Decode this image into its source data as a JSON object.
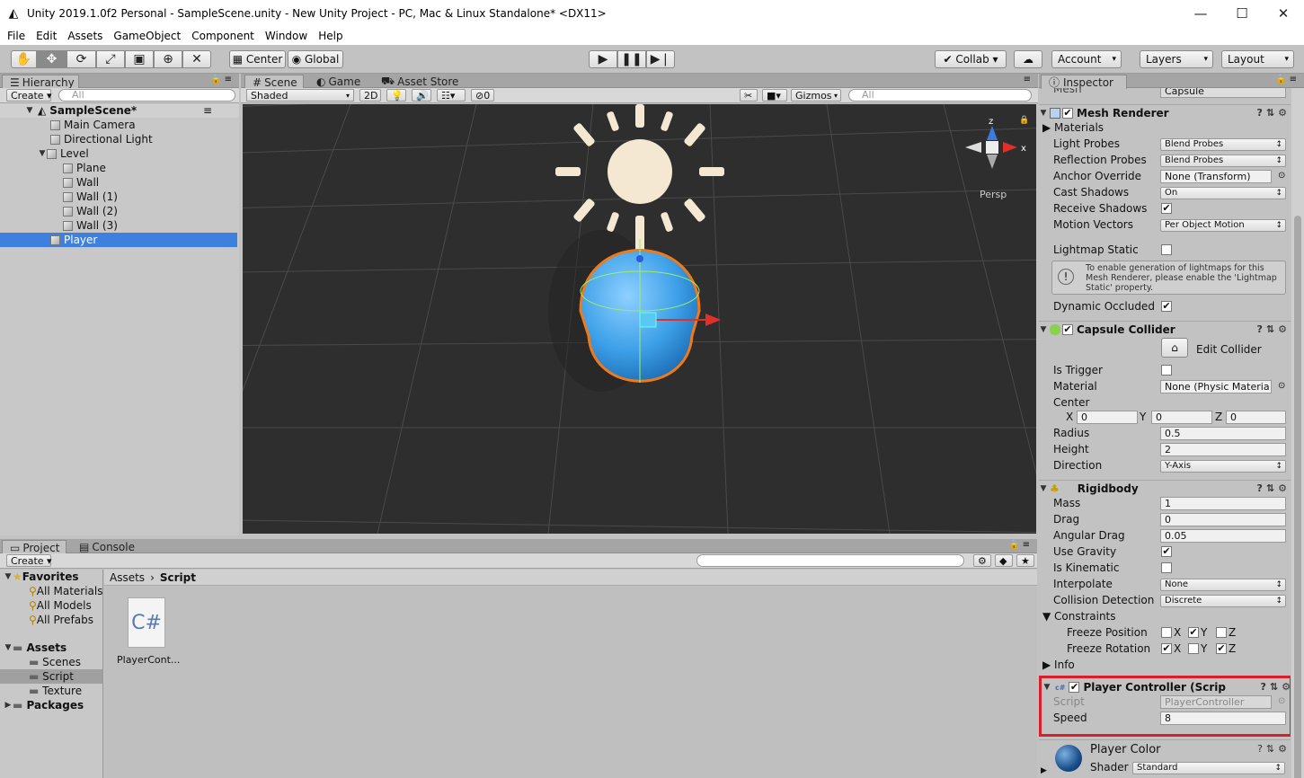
{
  "window": {
    "title": "Unity 2019.1.0f2 Personal - SampleScene.unity - New Unity Project - PC, Mac & Linux Standalone* <DX11>",
    "minimize": "—",
    "maximize": "☐",
    "close": "✕"
  },
  "menu": [
    "File",
    "Edit",
    "Assets",
    "GameObject",
    "Component",
    "Window",
    "Help"
  ],
  "toolbar": {
    "pivot": "Center",
    "space": "Global",
    "collab": "Collab ▾",
    "account": "Account",
    "layers": "Layers",
    "layout": "Layout"
  },
  "hierarchy": {
    "tab": "Hierarchy",
    "create": "Create",
    "search_placeholder": "All",
    "scene": "SampleScene*",
    "items": [
      "Main Camera",
      "Directional Light",
      "Level",
      "Plane",
      "Wall",
      "Wall (1)",
      "Wall (2)",
      "Wall (3)",
      "Player"
    ],
    "selected": "Player"
  },
  "scene": {
    "tabs": [
      "Scene",
      "Game",
      "Asset Store"
    ],
    "shading": "Shaded",
    "mode2d": "2D",
    "fx_count": "0",
    "gizmos": "Gizmos",
    "search_placeholder": "All",
    "persp": "Persp",
    "axis_x": "x",
    "axis_z": "z"
  },
  "project": {
    "tabs": [
      "Project",
      "Console"
    ],
    "create": "Create",
    "favorites": "Favorites",
    "favorite_items": [
      "All Materials",
      "All Models",
      "All Prefabs"
    ],
    "assets": "Assets",
    "asset_folders": [
      "Scenes",
      "Script",
      "Texture"
    ],
    "packages": "Packages",
    "breadcrumb": [
      "Assets",
      "Script"
    ],
    "file_icon": "C#",
    "file_name": "PlayerCont..."
  },
  "inspector": {
    "tab": "Inspector",
    "mesh_cutoff": "Mesh",
    "mesh_value": "Capsule",
    "mesh_renderer": {
      "title": "Mesh Renderer",
      "materials": "Materials",
      "light_probes": {
        "label": "Light Probes",
        "value": "Blend Probes"
      },
      "reflection_probes": {
        "label": "Reflection Probes",
        "value": "Blend Probes"
      },
      "anchor_override": {
        "label": "Anchor Override",
        "value": "None (Transform)"
      },
      "cast_shadows": {
        "label": "Cast Shadows",
        "value": "On"
      },
      "receive_shadows": "Receive Shadows",
      "motion_vectors": {
        "label": "Motion Vectors",
        "value": "Per Object Motion"
      },
      "lightmap_static": "Lightmap Static",
      "help": "To enable generation of lightmaps for this Mesh Renderer, please enable the 'Lightmap Static' property.",
      "dynamic_occluded": "Dynamic Occluded"
    },
    "capsule_collider": {
      "title": "Capsule Collider",
      "edit_collider": "Edit Collider",
      "is_trigger": "Is Trigger",
      "material": {
        "label": "Material",
        "value": "None (Physic Materia"
      },
      "center": "Center",
      "cx": "0",
      "cy": "0",
      "cz": "0",
      "radius": {
        "label": "Radius",
        "value": "0.5"
      },
      "height": {
        "label": "Height",
        "value": "2"
      },
      "direction": {
        "label": "Direction",
        "value": "Y-Axis"
      }
    },
    "rigidbody": {
      "title": "Rigidbody",
      "mass": {
        "label": "Mass",
        "value": "1"
      },
      "drag": {
        "label": "Drag",
        "value": "0"
      },
      "angular_drag": {
        "label": "Angular Drag",
        "value": "0.05"
      },
      "use_gravity": "Use Gravity",
      "is_kinematic": "Is Kinematic",
      "interpolate": {
        "label": "Interpolate",
        "value": "None"
      },
      "collision_detection": {
        "label": "Collision Detection",
        "value": "Discrete"
      },
      "constraints": "Constraints",
      "freeze_position": "Freeze Position",
      "freeze_rotation": "Freeze Rotation",
      "info": "Info"
    },
    "player_controller": {
      "title": "Player Controller (Scrip",
      "script": {
        "label": "Script",
        "value": "PlayerController"
      },
      "speed": {
        "label": "Speed",
        "value": "8"
      }
    },
    "material": {
      "name": "Player Color",
      "shader_label": "Shader",
      "shader_value": "Standard"
    }
  },
  "colors": {
    "selection": "#3d80e0",
    "highlight_box": "#d9202a",
    "capsule": "#3da0e8",
    "outline": "#f07a1a"
  },
  "xyz": {
    "x": "X",
    "y": "Y",
    "z": "Z"
  }
}
